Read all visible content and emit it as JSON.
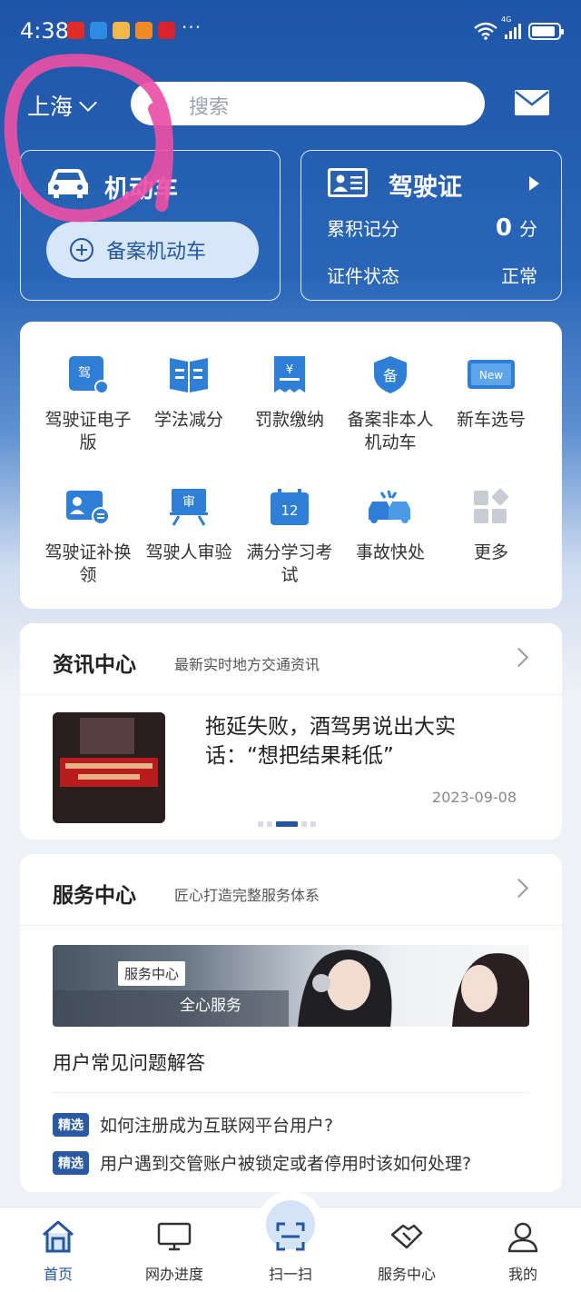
{
  "status_bar": {
    "time": "4:38",
    "more": "···",
    "network_label": "4G",
    "battery_level": 0.9,
    "notification_icons": [
      "xiaohongshu-icon",
      "browser-icon",
      "gallery-icon",
      "video-icon",
      "shop-icon"
    ]
  },
  "header": {
    "city": "上海",
    "search_placeholder": "搜索"
  },
  "motor_card": {
    "title": "机动车",
    "add_button": "备案机动车"
  },
  "license_card": {
    "title": "驾驶证",
    "score_label": "累积记分",
    "score_value": "0",
    "score_unit": "分",
    "status_label": "证件状态",
    "status_value": "正常"
  },
  "services": [
    {
      "label": "驾驶证电子版",
      "icon": "e-license-icon"
    },
    {
      "label": "学法减分",
      "icon": "book-icon"
    },
    {
      "label": "罚款缴纳",
      "icon": "fine-receipt-icon"
    },
    {
      "label": "备案非本人机动车",
      "icon": "shield-register-icon"
    },
    {
      "label": "新车选号",
      "icon": "new-plate-icon"
    },
    {
      "label": "驾驶证补换领",
      "icon": "license-renew-icon"
    },
    {
      "label": "驾驶人审验",
      "icon": "review-board-icon"
    },
    {
      "label": "满分学习考试",
      "icon": "calendar-12-icon"
    },
    {
      "label": "事故快处",
      "icon": "accident-icon"
    },
    {
      "label": "更多",
      "icon": "more-grid-icon"
    }
  ],
  "news": {
    "title": "资讯中心",
    "subtitle": "最新实时地方交通资讯",
    "headline": "拖延失败，酒驾男说出大实话：“想把结果耗低”",
    "date": "2023-09-08",
    "thumb_caption": "拖延失败，酒驾男说出大实话：“想把结果耗低”",
    "carousel_active": 2,
    "carousel_count": 5
  },
  "service_center": {
    "title": "服务中心",
    "subtitle": "匠心打造完整服务体系",
    "banner_tag": "服务中心",
    "banner_text": "全心服务",
    "faq_title": "用户常见问题解答",
    "faq": [
      {
        "tag": "精选",
        "text": "如何注册成为互联网平台用户?"
      },
      {
        "tag": "精选",
        "text": "用户遇到交管账户被锁定或者停用时该如何处理?"
      }
    ]
  },
  "tabbar": [
    {
      "label": "首页",
      "icon": "home-icon",
      "active": true
    },
    {
      "label": "网办进度",
      "icon": "monitor-icon",
      "active": false
    },
    {
      "label": "扫一扫",
      "icon": "scan-icon",
      "active": false
    },
    {
      "label": "服务中心",
      "icon": "handshake-icon",
      "active": false
    },
    {
      "label": "我的",
      "icon": "user-icon",
      "active": false
    }
  ],
  "colors": {
    "primary": "#2457a0",
    "hero_top": "#1e55a8",
    "icon_blue": "#2f7fd6",
    "annotation_pink": "#ea4fa6"
  }
}
